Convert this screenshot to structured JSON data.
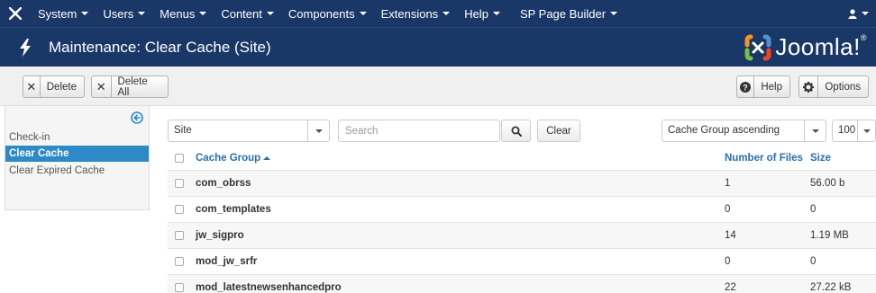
{
  "navbar": {
    "logo": "joomla-icon",
    "menus": [
      {
        "label": "System"
      },
      {
        "label": "Users"
      },
      {
        "label": "Menus"
      },
      {
        "label": "Content"
      },
      {
        "label": "Components"
      },
      {
        "label": "Extensions"
      },
      {
        "label": "Help"
      },
      {
        "label": "SP Page Builder"
      }
    ],
    "user_icon": "user-icon"
  },
  "header": {
    "icon": "lightning-icon",
    "title": "Maintenance: Clear Cache (Site)",
    "brand": "Joomla!"
  },
  "toolbar": {
    "delete_label": "Delete",
    "delete_all_label": "Delete All",
    "help_label": "Help",
    "options_label": "Options"
  },
  "sidebar": {
    "items": [
      {
        "label": "Check-in",
        "active": false
      },
      {
        "label": "Clear Cache",
        "active": true
      },
      {
        "label": "Clear Expired Cache",
        "active": false
      }
    ]
  },
  "filters": {
    "client_value": "Site",
    "search_placeholder": "Search",
    "clear_label": "Clear",
    "ordering_value": "Cache Group ascending",
    "limit_value": "100"
  },
  "table": {
    "headers": {
      "group": "Cache Group",
      "files": "Number of Files",
      "size": "Size"
    },
    "rows": [
      {
        "group": "com_obrss",
        "files": "1",
        "size": "56.00 b"
      },
      {
        "group": "com_templates",
        "files": "0",
        "size": "0"
      },
      {
        "group": "jw_sigpro",
        "files": "14",
        "size": "1.19 MB"
      },
      {
        "group": "mod_jw_srfr",
        "files": "0",
        "size": "0"
      },
      {
        "group": "mod_latestnewsenhancedpro",
        "files": "22",
        "size": "27.22 kB"
      }
    ]
  },
  "colors": {
    "nav_bg": "#1a3867",
    "active_sidebar": "#2d8ac7",
    "link": "#2a6ead"
  }
}
